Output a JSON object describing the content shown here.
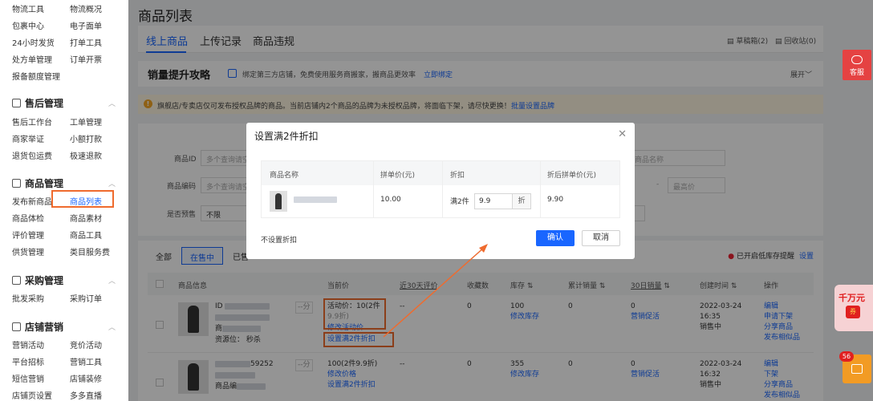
{
  "sidebar": {
    "top_rows": [
      [
        "物流工具",
        "物流概况"
      ],
      [
        "包裹中心",
        "电子面单"
      ],
      [
        "24小时发货",
        "打单工具"
      ],
      [
        "处方单管理",
        "订单开票"
      ]
    ],
    "top_single": "报备额度管理",
    "sections": [
      {
        "title": "售后管理",
        "rows": [
          [
            "售后工作台",
            "工单管理"
          ],
          [
            "商家举证",
            "小额打款"
          ],
          [
            "退货包运费",
            "极速退款"
          ]
        ]
      },
      {
        "title": "商品管理",
        "rows": [
          [
            "发布新商品",
            "商品列表"
          ],
          [
            "商品体检",
            "商品素材"
          ],
          [
            "评价管理",
            "商品工具"
          ],
          [
            "供货管理",
            "类目服务费"
          ]
        ]
      },
      {
        "title": "采购管理",
        "rows": [
          [
            "批发采购",
            "采购订单"
          ]
        ]
      },
      {
        "title": "店铺营销",
        "rows": [
          [
            "营销活动",
            "竞价活动"
          ],
          [
            "平台招标",
            "营销工具"
          ],
          [
            "短信营销",
            "店铺装修"
          ],
          [
            "店铺页设置",
            "多多直播"
          ]
        ]
      }
    ]
  },
  "page_title": "商品列表",
  "tabs": [
    "线上商品",
    "上传记录",
    "商品违规"
  ],
  "tab_right": {
    "draft": "草稿箱(2)",
    "recycle": "回收站(0)"
  },
  "strategy": {
    "title": "销量提升攻略",
    "text": "绑定第三方店铺，免费使用服务商搬家，搬商品更效率",
    "link": "立即绑定",
    "more": "展开"
  },
  "warning": {
    "text": "旗舰店/专卖店仅可发布授权品牌的商品。当前店铺内2个商品的品牌为未授权品牌，将面临下架，请尽快更换！",
    "link": "批量设置品牌"
  },
  "filters": {
    "product_id_label": "商品ID",
    "product_id_placeholder": "多个查询请空",
    "product_code_label": "商品编码",
    "product_code_placeholder": "多个查询请空",
    "presale_label": "是否预售",
    "presale_value": "不限",
    "right_placeholder_1": "商品名称",
    "range_sep": "-",
    "right_placeholder_2": "最高价"
  },
  "status_tabs": [
    "全部",
    "在售中",
    "已售"
  ],
  "low_stock": {
    "text": "已开启低库存提醒",
    "setting": "设置"
  },
  "table_headers": [
    "商品信息",
    "当前价",
    "近30天评价",
    "收藏数",
    "库存",
    "累计销量",
    "30日销量",
    "创建时间",
    "操作"
  ],
  "rows": [
    {
      "id_prefix": "ID",
      "name_prefix": "商",
      "stock_label": "资源位：",
      "stock_value": "秒杀",
      "price_line1": "活动价：10(2件",
      "price_line2": "9.9折)",
      "price_edit": "修改活动价",
      "set_discount": "设置满2件折扣",
      "rating": "--",
      "favorites": "0",
      "stock": "100",
      "stock_edit": "修改库存",
      "total_sales": "0",
      "sales_30": "0",
      "promo": "营销促活",
      "date": "2022-03-24",
      "time": "16:35",
      "status": "销售中",
      "actions": [
        "编辑",
        "申请下架",
        "分享商品",
        "发布相似品"
      ],
      "dash": "--分"
    },
    {
      "id_suffix": "59252",
      "name_prefix": "商品编",
      "price_line1": "100(2件9.9折)",
      "price_edit": "修改价格",
      "set_discount": "设置满2件折扣",
      "rating": "--",
      "favorites": "0",
      "stock": "355",
      "stock_edit": "修改库存",
      "total_sales": "0",
      "sales_30": "0",
      "promo": "营销促活",
      "date": "2022-03-24",
      "time": "16:32",
      "status": "销售中",
      "actions": [
        "编辑",
        "下架",
        "分享商品",
        "发布相似品"
      ],
      "dash": "--分"
    }
  ],
  "modal": {
    "title": "设置满2件折扣",
    "headers": [
      "商品名称",
      "拼单价(元)",
      "折扣",
      "折后拼单价(元)"
    ],
    "price": "10.00",
    "discount_prefix": "满2件",
    "discount_value": "9.9",
    "discount_suffix": "折",
    "after_price": "9.90",
    "no_discount": "不设置折扣",
    "confirm": "确认",
    "cancel": "取消"
  },
  "customer_service": "客服",
  "promo_widget": {
    "text": "千万元",
    "badge": "券"
  },
  "cart_badge": "56",
  "colors": {
    "accent": "#1966ff",
    "highlight": "#ef6b2e"
  }
}
